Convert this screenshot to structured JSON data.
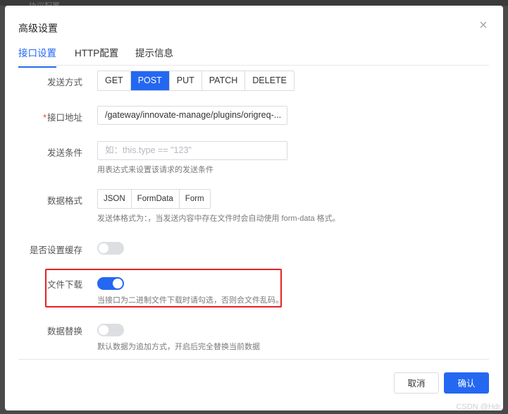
{
  "backdrop": {
    "text": "…协议配置"
  },
  "dialog": {
    "title": "高级设置",
    "close_symbol": "×"
  },
  "tabs": [
    {
      "label": "接口设置",
      "active": true
    },
    {
      "label": "HTTP配置",
      "active": false
    },
    {
      "label": "提示信息",
      "active": false
    }
  ],
  "form": {
    "method": {
      "label": "发送方式",
      "options": [
        "GET",
        "POST",
        "PUT",
        "PATCH",
        "DELETE"
      ],
      "selected": "POST"
    },
    "url": {
      "required_mark": "*",
      "label": "接口地址",
      "value": "/gateway/innovate-manage/plugins/origreq-..."
    },
    "condition": {
      "label": "发送条件",
      "placeholder": "如：this.type == \"123\"",
      "hint": "用表达式来设置该请求的发送条件"
    },
    "data_format": {
      "label": "数据格式",
      "options": [
        "JSON",
        "FormData",
        "Form"
      ],
      "hint": "发送体格式为：，当发送内容中存在文件时会自动使用 form-data 格式。"
    },
    "cache": {
      "label": "是否设置缓存",
      "on": false
    },
    "file_download": {
      "label": "文件下载",
      "on": true,
      "hint": "当接口为二进制文件下载时请勾选，否则会文件乱码。"
    },
    "data_replace": {
      "label": "数据替换",
      "on": false,
      "hint": "默认数据为追加方式，开启后完全替换当前数据"
    }
  },
  "footer": {
    "cancel_label": "取消",
    "ok_label": "确认"
  },
  "watermark": "CSDN @Hdr.",
  "colors": {
    "primary": "#2468f2",
    "highlight_border": "#e5221f"
  }
}
